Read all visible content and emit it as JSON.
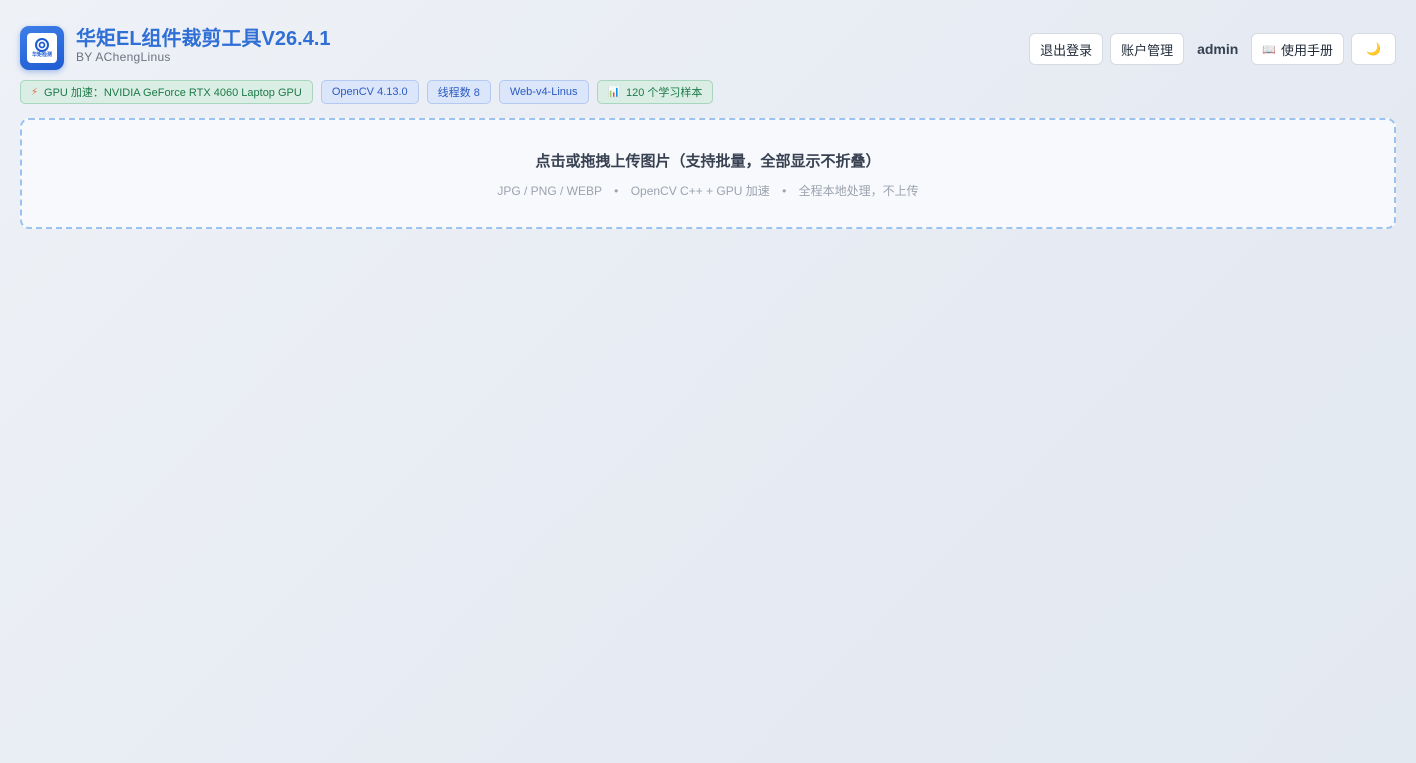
{
  "app": {
    "title": "华矩EL组件裁剪工具V26.4.1",
    "subtitle": "BY AChengLinus",
    "logo_text": "华矩检测",
    "accent": "#2f6fd6"
  },
  "header": {
    "logout_label": "退出登录",
    "account_label": "账户管理",
    "username": "admin",
    "manual_label": "使用手册",
    "manual_icon": "📖",
    "theme_icon": "🌙"
  },
  "badges": {
    "gpu": {
      "icon": "⚡",
      "label": "GPU 加速：NVIDIA GeForce RTX 4060 Laptop GPU"
    },
    "opencv": "OpenCV 4.13.0",
    "threads": "线程数 8",
    "web": "Web-v4-Linus",
    "samples": {
      "icon": "📊",
      "label": "120 个学习样本"
    }
  },
  "upload": {
    "title": "点击或拖拽上传图片（支持批量，全部显示不折叠）",
    "formats": "JPG / PNG / WEBP",
    "engine": "OpenCV C++ + GPU 加速",
    "privacy": "全程本地处理，不上传",
    "separator": "•"
  }
}
